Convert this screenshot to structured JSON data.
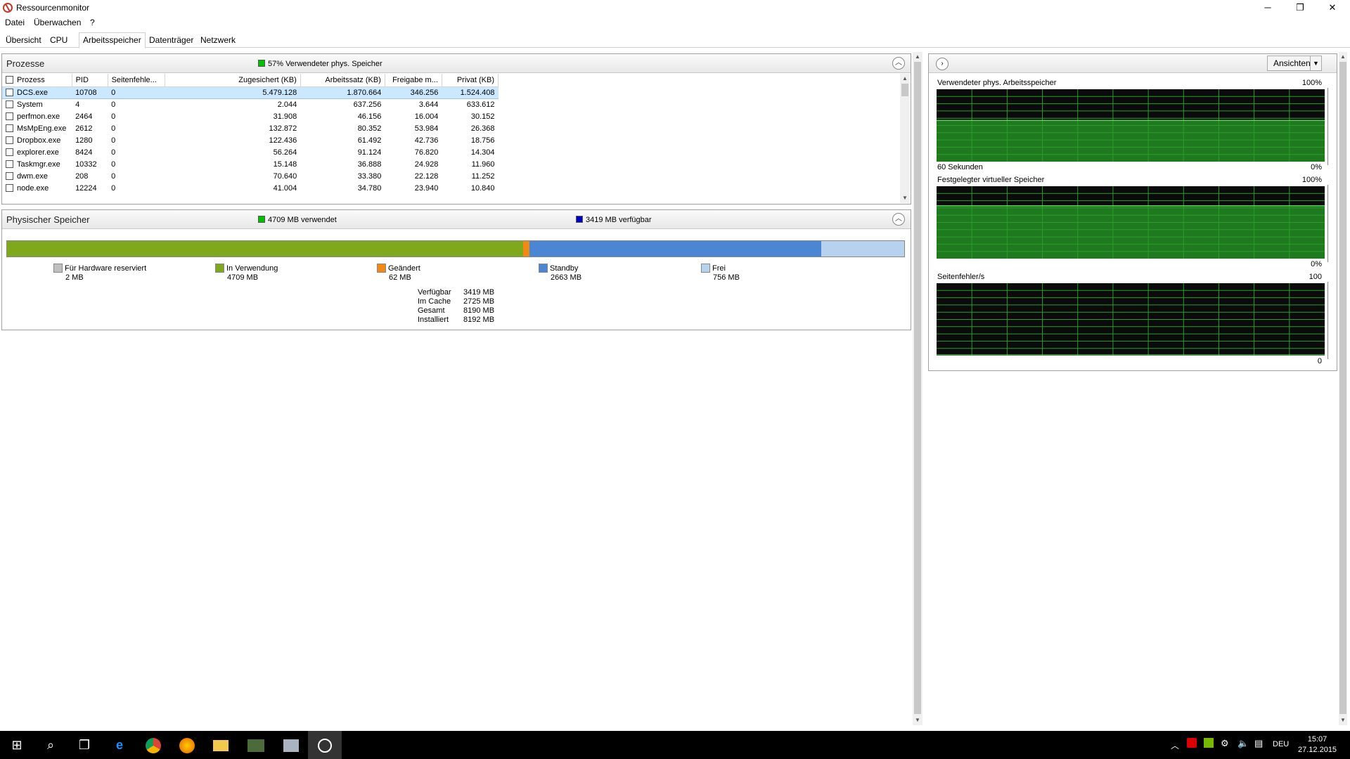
{
  "window": {
    "title": "Ressourcenmonitor",
    "minimize": "─",
    "maximize": "❐",
    "close": "✕"
  },
  "menu": [
    "Datei",
    "Überwachen",
    "?"
  ],
  "tabs": [
    "Übersicht",
    "CPU",
    "Arbeitsspeicher",
    "Datenträger",
    "Netzwerk"
  ],
  "active_tab": "Arbeitsspeicher",
  "processes": {
    "title": "Prozesse",
    "summary": "57% Verwendeter phys. Speicher",
    "summary_color": "#00c000",
    "columns": [
      "Prozess",
      "PID",
      "Seitenfehle...",
      "Zugesichert (KB)",
      "Arbeitssatz (KB)",
      "Freigabe m...",
      "Privat (KB)"
    ],
    "rows": [
      [
        "DCS.exe",
        "10708",
        "0",
        "5.479.128",
        "1.870.664",
        "346.256",
        "1.524.408"
      ],
      [
        "System",
        "4",
        "0",
        "2.044",
        "637.256",
        "3.644",
        "633.612"
      ],
      [
        "perfmon.exe",
        "2464",
        "0",
        "31.908",
        "46.156",
        "16.004",
        "30.152"
      ],
      [
        "MsMpEng.exe",
        "2612",
        "0",
        "132.872",
        "80.352",
        "53.984",
        "26.368"
      ],
      [
        "Dropbox.exe",
        "1280",
        "0",
        "122.436",
        "61.492",
        "42.736",
        "18.756"
      ],
      [
        "explorer.exe",
        "8424",
        "0",
        "56.264",
        "91.124",
        "76.820",
        "14.304"
      ],
      [
        "Taskmgr.exe",
        "10332",
        "0",
        "15.148",
        "36.888",
        "24.928",
        "11.960"
      ],
      [
        "dwm.exe",
        "208",
        "0",
        "70.640",
        "33.380",
        "22.128",
        "11.252"
      ],
      [
        "node.exe",
        "12224",
        "0",
        "41.004",
        "34.780",
        "23.940",
        "10.840"
      ]
    ]
  },
  "physical": {
    "title": "Physischer Speicher",
    "used_label": "4709 MB verwendet",
    "available_label": "3419 MB verfügbar",
    "used_color": "#00c000",
    "available_color": "#0000c0",
    "bar": [
      {
        "name": "Für Hardware reserviert",
        "value": "2 MB",
        "mb": 2,
        "color": "#bfbfbf"
      },
      {
        "name": "In Verwendung",
        "value": "4709 MB",
        "mb": 4709,
        "color": "#80a81c"
      },
      {
        "name": "Geändert",
        "value": "62 MB",
        "mb": 62,
        "color": "#f08a12"
      },
      {
        "name": "Standby",
        "value": "2663 MB",
        "mb": 2663,
        "color": "#4a86d4"
      },
      {
        "name": "Frei",
        "value": "756 MB",
        "mb": 756,
        "color": "#b7d2ee"
      }
    ],
    "summary": [
      {
        "label": "Verfügbar",
        "value": "3419 MB"
      },
      {
        "label": "Im Cache",
        "value": "2725 MB"
      },
      {
        "label": "Gesamt",
        "value": "8190 MB"
      },
      {
        "label": "Installiert",
        "value": "8192 MB"
      }
    ]
  },
  "graphs_panel": {
    "views_button": "Ansichten",
    "graphs": [
      {
        "label": "Verwendeter phys. Arbeitsspeicher",
        "max": "100%",
        "min": "0%",
        "footer": "60 Sekunden",
        "level": 0.57
      },
      {
        "label": "Festgelegter virtueller Speicher",
        "max": "100%",
        "min": "0%",
        "footer": "",
        "level": 0.73
      },
      {
        "label": "Seitenfehler/s",
        "max": "100",
        "min": "0",
        "footer": "",
        "level": 0.0
      }
    ]
  },
  "taskbar": {
    "icons": [
      "windows-start-icon",
      "search-icon",
      "task-view-icon",
      "edge-icon",
      "chrome-icon",
      "firefox-icon",
      "file-explorer-icon",
      "dcs-icon",
      "resource-monitor-app-icon",
      "resource-monitor-icon"
    ],
    "language": "DEU",
    "time": "15:07",
    "date": "27.12.2015"
  }
}
